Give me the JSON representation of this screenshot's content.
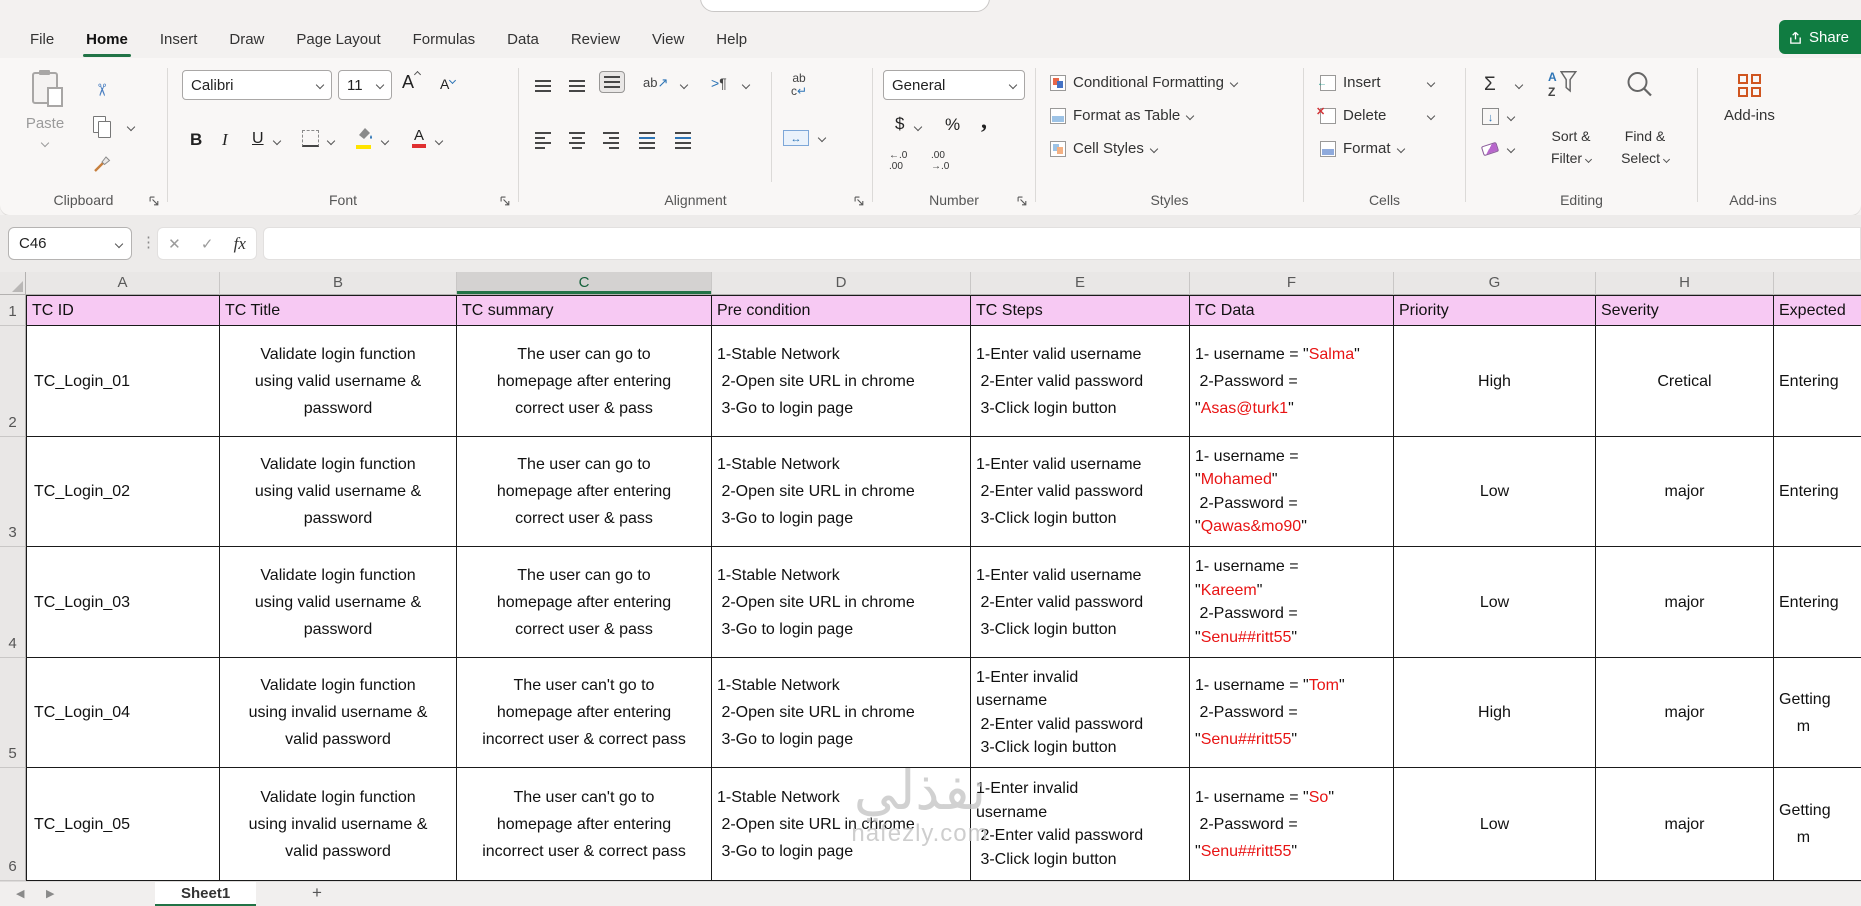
{
  "chrome": {
    "share": "Share",
    "menu_tabs": [
      "File",
      "Home",
      "Insert",
      "Draw",
      "Page Layout",
      "Formulas",
      "Data",
      "Review",
      "View",
      "Help"
    ],
    "active_tab": "Home"
  },
  "ribbon": {
    "clipboard": {
      "group": "Clipboard",
      "paste": "Paste"
    },
    "font": {
      "group": "Font",
      "family": "Calibri",
      "size": "11",
      "bold": "B",
      "italic": "I",
      "underline": "U"
    },
    "alignment": {
      "group": "Alignment"
    },
    "number": {
      "group": "Number",
      "format": "General",
      "currency": "$",
      "percent": "%",
      "comma": ",",
      "inc_decimal": "←.0\n.00",
      "dec_decimal": ".00\n→.0"
    },
    "styles": {
      "group": "Styles",
      "conditional": "Conditional Formatting",
      "format_table": "Format as Table",
      "cell_styles": "Cell Styles"
    },
    "cells": {
      "group": "Cells",
      "insert": "Insert",
      "delete": "Delete",
      "format": "Format"
    },
    "editing": {
      "group": "Editing",
      "sum": "Σ",
      "sort1": "Sort &",
      "sort2": "Filter",
      "find1": "Find &",
      "find2": "Select"
    },
    "addins": {
      "group": "Add-ins",
      "label": "Add-ins"
    }
  },
  "formula_bar": {
    "name_box": "C46",
    "formula": ""
  },
  "sheet": {
    "col_letters": [
      "A",
      "B",
      "C",
      "D",
      "E",
      "F",
      "G",
      "H",
      ""
    ],
    "selected_col": "C",
    "header_row": {
      "num": "1",
      "cells": [
        "TC ID",
        "TC Title",
        "TC summary",
        "Pre condition",
        "TC Steps",
        "TC Data",
        "Priority",
        "Severity",
        "Expected"
      ]
    },
    "rows": [
      {
        "num": "2",
        "id": "TC_Login_01",
        "title": [
          "Validate login function",
          "using valid username &",
          "password"
        ],
        "summary": [
          "The user can go to",
          "homepage after entering",
          "correct user & pass"
        ],
        "pre": [
          "1-Stable Network",
          " 2-Open site URL in chrome",
          " 3-Go to login page"
        ],
        "steps": [
          "1-Enter valid username",
          " 2-Enter valid password",
          " 3-Click login button"
        ],
        "tc_data": [
          [
            [
              "1- username = \"",
              0
            ],
            [
              "Salma",
              1
            ],
            [
              "\"",
              0
            ]
          ],
          [
            [
              " 2-Password =",
              0
            ]
          ],
          [
            [
              "\"",
              0
            ],
            [
              "Asas@turk1",
              1
            ],
            [
              "\"",
              0
            ]
          ]
        ],
        "priority": "High",
        "severity": "Cretical",
        "expected": [
          "Entering"
        ]
      },
      {
        "num": "3",
        "id": "TC_Login_02",
        "title": [
          "Validate login function",
          "using valid username &",
          "password"
        ],
        "summary": [
          "The user can go to",
          "homepage after entering",
          "correct user & pass"
        ],
        "pre": [
          "1-Stable Network",
          " 2-Open site URL in chrome",
          " 3-Go to login page"
        ],
        "steps": [
          "1-Enter valid username",
          " 2-Enter valid password",
          " 3-Click login button"
        ],
        "tc_data": [
          [
            [
              "1- username =",
              0
            ]
          ],
          [
            [
              "\"",
              0
            ],
            [
              "Mohamed",
              1
            ],
            [
              "\"",
              0
            ]
          ],
          [
            [
              " 2-Password =",
              0
            ]
          ],
          [
            [
              "\"",
              0
            ],
            [
              "Qawas&mo90",
              1
            ],
            [
              "\"",
              0
            ]
          ]
        ],
        "priority": "Low",
        "severity": "major",
        "expected": [
          "Entering"
        ]
      },
      {
        "num": "4",
        "id": "TC_Login_03",
        "title": [
          "Validate login function",
          "using valid username &",
          "password"
        ],
        "summary": [
          "The user can go to",
          "homepage after entering",
          "correct user & pass"
        ],
        "pre": [
          "1-Stable Network",
          " 2-Open site URL in chrome",
          " 3-Go to login page"
        ],
        "steps": [
          "1-Enter valid username",
          " 2-Enter valid password",
          " 3-Click login button"
        ],
        "tc_data": [
          [
            [
              "1- username =",
              0
            ]
          ],
          [
            [
              "\"",
              0
            ],
            [
              "Kareem",
              1
            ],
            [
              "\"",
              0
            ]
          ],
          [
            [
              " 2-Password =",
              0
            ]
          ],
          [
            [
              "\"",
              0
            ],
            [
              "Senu##ritt55",
              1
            ],
            [
              "\"",
              0
            ]
          ]
        ],
        "priority": "Low",
        "severity": "major",
        "expected": [
          "Entering"
        ]
      },
      {
        "num": "5",
        "id": "TC_Login_04",
        "title": [
          "Validate login function",
          "using invalid username &",
          "valid password"
        ],
        "summary": [
          "The user can't go to",
          "homepage after entering",
          "incorrect user & correct pass"
        ],
        "pre": [
          "1-Stable Network",
          " 2-Open site URL in chrome",
          " 3-Go to login page"
        ],
        "steps": [
          "1-Enter invalid",
          "username",
          " 2-Enter valid password",
          " 3-Click login button"
        ],
        "tc_data": [
          [
            [
              "1- username = \"",
              0
            ],
            [
              "Tom",
              1
            ],
            [
              "\"",
              0
            ]
          ],
          [
            [
              " 2-Password =",
              0
            ]
          ],
          [
            [
              "\"",
              0
            ],
            [
              "Senu##ritt55",
              1
            ],
            [
              "\"",
              0
            ]
          ]
        ],
        "priority": "High",
        "severity": "major",
        "expected": [
          "Getting",
          "    m"
        ]
      },
      {
        "num": "6",
        "id": "TC_Login_05",
        "title": [
          "Validate login function",
          "using invalid username &",
          "valid password"
        ],
        "summary": [
          "The user can't go to",
          "homepage after entering",
          "incorrect user & correct pass"
        ],
        "pre": [
          "1-Stable Network",
          " 2-Open site URL in chrome",
          " 3-Go to login page"
        ],
        "steps": [
          "1-Enter invalid",
          "username",
          " 2-Enter valid password",
          " 3-Click login button"
        ],
        "tc_data": [
          [
            [
              "1- username = \"",
              0
            ],
            [
              "So",
              1
            ],
            [
              "\"",
              0
            ]
          ],
          [
            [
              " 2-Password =",
              0
            ]
          ],
          [
            [
              "\"",
              0
            ],
            [
              "Senu##ritt55",
              1
            ],
            [
              "\"",
              0
            ]
          ]
        ],
        "priority": "Low",
        "severity": "major",
        "expected": [
          "Getting",
          "    m"
        ]
      }
    ]
  },
  "tabs_bar": {
    "sheet": "Sheet1"
  },
  "watermark": {
    "line1": "نفذلي",
    "line2": "nafezly.com"
  },
  "colors": {
    "header_fill": "#f7c9f3",
    "red": "#e81313",
    "green": "#217346",
    "share_green": "#107c41"
  }
}
